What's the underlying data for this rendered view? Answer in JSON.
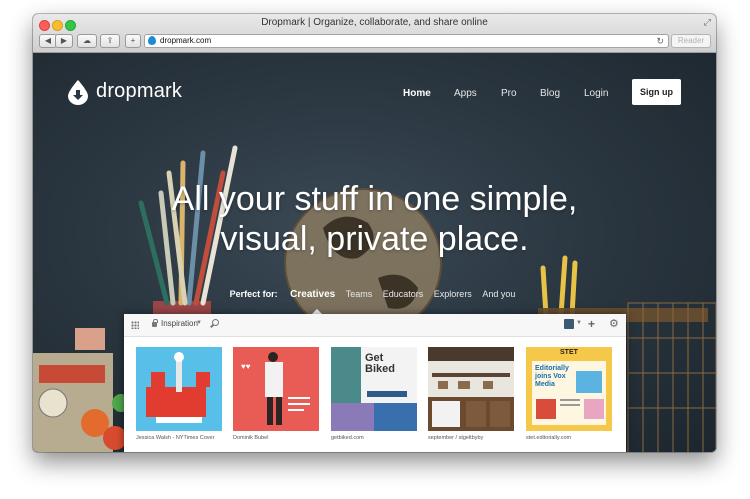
{
  "window": {
    "title": "Dropmark | Organize, collaborate, and share online"
  },
  "toolbar": {
    "url": "dropmark.com",
    "reader_label": "Reader"
  },
  "site": {
    "logo_text": "dropmark",
    "nav": [
      {
        "label": "Home",
        "active": true
      },
      {
        "label": "Apps"
      },
      {
        "label": "Pro"
      },
      {
        "label": "Blog"
      },
      {
        "label": "Login"
      }
    ],
    "signup_label": "Sign up",
    "headline_line1": "All your stuff in one simple,",
    "headline_line2": "visual, private place.",
    "perfect_for": {
      "label": "Perfect for:",
      "items": [
        "Creatives",
        "Teams",
        "Educators",
        "Explorers",
        "And you"
      ],
      "active": "Creatives"
    }
  },
  "collection": {
    "name": "Inspiration",
    "items": [
      {
        "caption": "Jessica Walsh - NYTimes Cover"
      },
      {
        "caption": "Dominik Bubel"
      },
      {
        "caption": "getbiked.com",
        "title": "Get Biked"
      },
      {
        "caption": "september / stgeltbyby"
      },
      {
        "caption": "stet.editorially.com",
        "title": "Editorially joins Vox Media",
        "badge": "STET"
      }
    ]
  },
  "colors": {
    "accent": "#1a8cd8",
    "signup_bg": "#ffffff",
    "hero_bg": "#2b3741"
  }
}
